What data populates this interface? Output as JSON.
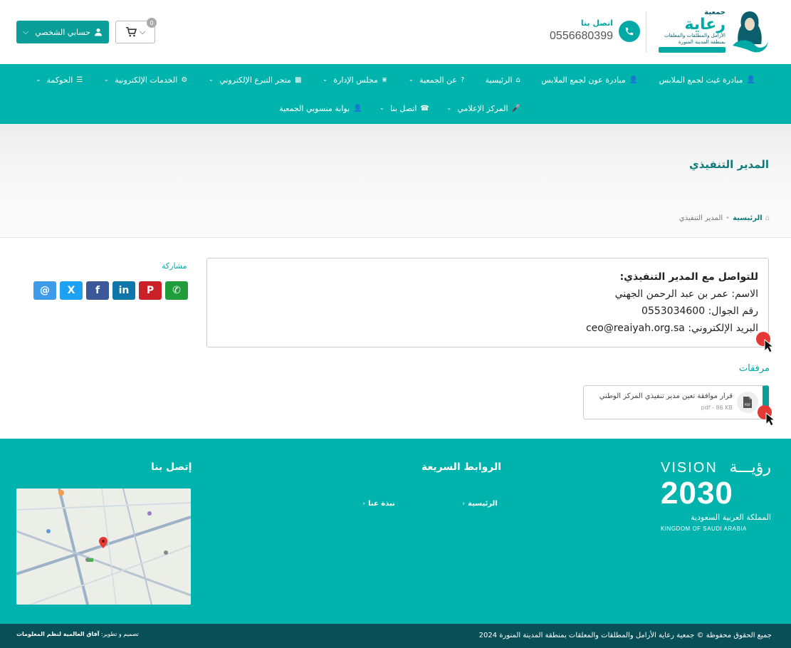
{
  "header": {
    "logo": {
      "small": "جمعية",
      "big": "رعاية",
      "line1": "الأرامل والمطلقات والمعلقات",
      "line2": "بمنطقة المدينة المنورة"
    },
    "contact_label": "اتصل بنا",
    "contact_number": "0556680399",
    "account_label": "حسابي الشخصي",
    "cart_count": "0"
  },
  "nav": {
    "row1": [
      {
        "label": "مبادرة غيث لجمع الملابس",
        "icon": "user-icon",
        "dropdown": false
      },
      {
        "label": "مبادرة عون لجمع الملابس",
        "icon": "user-icon",
        "dropdown": false
      },
      {
        "label": "الرئيسية",
        "icon": "home-icon",
        "dropdown": false
      },
      {
        "label": "عن الجمعية",
        "icon": "question-icon",
        "dropdown": true
      },
      {
        "label": "مجلس الإدارة",
        "icon": "sitemap-icon",
        "dropdown": true
      },
      {
        "label": "متجر التبرع الإلكتروني",
        "icon": "card-icon",
        "dropdown": true
      },
      {
        "label": "الخدمات الإلكترونية",
        "icon": "gears-icon",
        "dropdown": true
      },
      {
        "label": "الحوكمة",
        "icon": "list-icon",
        "dropdown": true
      }
    ],
    "row2": [
      {
        "label": "المركز الإعلامي",
        "icon": "mic-icon",
        "dropdown": true
      },
      {
        "label": "اتصل بنا",
        "icon": "phone-icon",
        "dropdown": true
      },
      {
        "label": "بوابة منسوبي الجمعية",
        "icon": "user-icon",
        "dropdown": false
      }
    ]
  },
  "page": {
    "title": "المدير التنفيذي",
    "breadcrumb_home": "الرئيسية",
    "breadcrumb_current": "المدير التنفيذي"
  },
  "content": {
    "heading": "للتواصل مع المدير التنفيذي:",
    "name": "الاسم: عمر بن عبد الرحمن الجهني",
    "mobile": "رقم الجوال: 0553034600",
    "email": "البريد الإلكتروني: ceo@reaiyah.org.sa"
  },
  "share": {
    "title": "مشاركة",
    "buttons": [
      {
        "name": "email-share-icon",
        "color": "#3d9be9",
        "glyph": "@"
      },
      {
        "name": "x-share-icon",
        "color": "#1da1f2",
        "glyph": "X"
      },
      {
        "name": "facebook-share-icon",
        "color": "#3b5998",
        "glyph": "f"
      },
      {
        "name": "linkedin-share-icon",
        "color": "#0e76a8",
        "glyph": "in"
      },
      {
        "name": "pinterest-share-icon",
        "color": "#cb2027",
        "glyph": "P"
      },
      {
        "name": "whatsapp-share-icon",
        "color": "#1e9d3a",
        "glyph": "✆"
      }
    ]
  },
  "attachments": {
    "title": "مرفقات",
    "file_name": "قرار موافقة تعين مدير تنفيذي المركز الوطني",
    "file_meta": "pdf - 86 KB"
  },
  "footer": {
    "vision": {
      "word_ar": "رؤيـــة",
      "word_en": "VISION",
      "year": "2030",
      "kingdom_ar": "المملكة العربية السعودية",
      "kingdom_en": "KINGDOM OF SAUDI ARABIA"
    },
    "quick_links_title": "الروابط السريعة",
    "quick_links": [
      "الرئيسية",
      "نبذة عنا"
    ],
    "contact_title": "إتصل بنا",
    "copyright": "جميع الحقوق محفوظة © جمعية رعاية الأرامل والمطلقات والمعلقات بمنطقة المدينة المنورة 2024",
    "design_prefix": "تصميم و تطوير:",
    "design_company": "آفاق العالمية لنظم المعلومات"
  },
  "colors": {
    "primary": "#00b3ad",
    "dark": "#094f57",
    "title": "#0f7b7b"
  }
}
